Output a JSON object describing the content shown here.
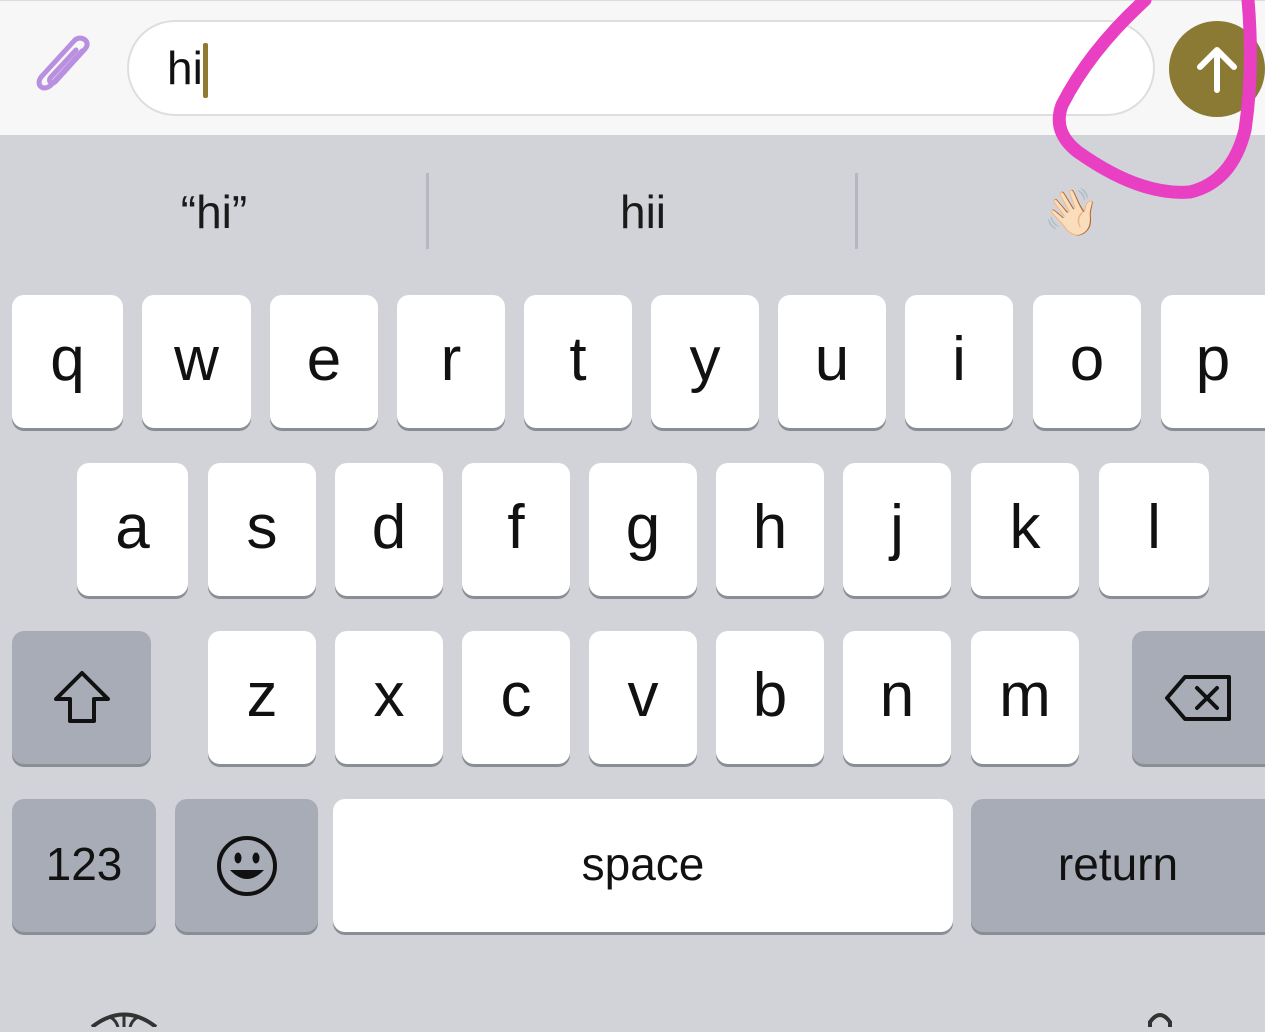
{
  "composer": {
    "input_value": "hi",
    "attach_icon": "paperclip-icon",
    "send_icon": "arrow-up-icon",
    "send_color": "#8b7a33"
  },
  "suggestions": [
    "“hi”",
    "hii",
    "👋🏻"
  ],
  "keyboard": {
    "row1": [
      "q",
      "w",
      "e",
      "r",
      "t",
      "y",
      "u",
      "i",
      "o",
      "p"
    ],
    "row2": [
      "a",
      "s",
      "d",
      "f",
      "g",
      "h",
      "j",
      "k",
      "l"
    ],
    "row3": [
      "z",
      "x",
      "c",
      "v",
      "b",
      "n",
      "m"
    ],
    "numbers_label": "123",
    "space_label": "space",
    "return_label": "return",
    "shift_icon": "shift-icon",
    "backspace_icon": "backspace-icon",
    "emoji_icon": "emoji-icon",
    "globe_icon": "globe-icon",
    "mic_icon": "microphone-icon"
  },
  "annotation_color": "#e83fc3"
}
